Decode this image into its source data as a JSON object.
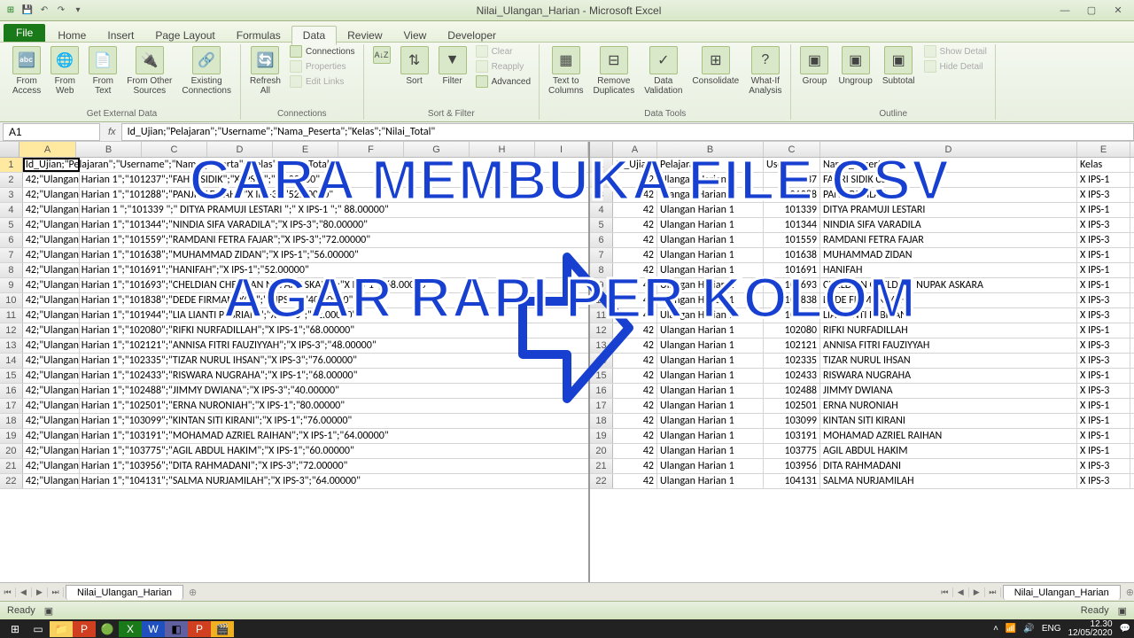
{
  "window": {
    "title": "Nilai_Ulangan_Harian - Microsoft Excel"
  },
  "tabs": {
    "file": "File",
    "list": [
      "Home",
      "Insert",
      "Page Layout",
      "Formulas",
      "Data",
      "Review",
      "View",
      "Developer"
    ],
    "active": "Data"
  },
  "ribbon": {
    "get_ext": {
      "label": "Get External Data",
      "btns": [
        "From\nAccess",
        "From\nWeb",
        "From\nText",
        "From Other\nSources",
        "Existing\nConnections"
      ]
    },
    "conn": {
      "label": "Connections",
      "refresh": "Refresh\nAll",
      "items": [
        "Connections",
        "Properties",
        "Edit Links"
      ]
    },
    "sort": {
      "label": "Sort & Filter",
      "sort": "Sort",
      "filter": "Filter",
      "items": [
        "Clear",
        "Reapply",
        "Advanced"
      ]
    },
    "tools": {
      "label": "Data Tools",
      "btns": [
        "Text to\nColumns",
        "Remove\nDuplicates",
        "Data\nValidation",
        "Consolidate",
        "What-If\nAnalysis"
      ]
    },
    "outline": {
      "label": "Outline",
      "btns": [
        "Group",
        "Ungroup",
        "Subtotal"
      ],
      "items": [
        "Show Detail",
        "Hide Detail"
      ]
    }
  },
  "fx": {
    "name": "A1",
    "formula": "Id_Ujian;\"Pelajaran\";\"Username\";\"Nama_Peserta\";\"Kelas\";\"Nilai_Total\""
  },
  "left_cols": [
    "A",
    "B",
    "C",
    "D",
    "E",
    "F",
    "G",
    "H",
    "I"
  ],
  "left_widths": [
    64,
    74,
    74,
    74,
    74,
    74,
    74,
    74,
    60
  ],
  "right_cols": [
    "A",
    "B",
    "C",
    "D",
    "E"
  ],
  "right_widths": [
    50,
    120,
    64,
    290,
    60
  ],
  "rows_left": [
    "Id_Ujian;\"Pelajaran\";\"Username\";\"Nama_Peserta\";\"Kelas\";\"Nilai_Total\"",
    "42;\"Ulangan Harian 1\";\"101237\";\"FAHRI SIDIK\";\"X IPS-1\";\"24.00000\"",
    "42;\"Ulangan Harian 1\";\"101288\";\"PANJI PADILAH\";\"X IPS-3\";\"52.00000\"",
    "42;\"Ulangan Harian 1 \";\"101339 \";\" DITYA PRAMUJI LESTARI \";\" X IPS-1 \";\" 88.00000\"",
    "42;\"Ulangan Harian 1\";\"101344\";\"NINDIA SIFA VARADILA\";\"X IPS-3\";\"80.00000\"",
    "42;\"Ulangan Harian 1\";\"101559\";\"RAMDANI FETRA FAJAR\";\"X IPS-3\";\"72.00000\"",
    "42;\"Ulangan Harian 1\";\"101638\";\"MUHAMMAD ZIDAN\";\"X IPS-1\";\"56.00000\"",
    "42;\"Ulangan Harian 1\";\"101691\";\"HANIFAH\";\"X IPS-1\";\"52.00000\"",
    "42;\"Ulangan Harian 1\";\"101693\";\"CHELDIAN CHELDIAN NUPAK ASKARA\";\"X IPS-1\";\"68.00000\"",
    "42;\"Ulangan Harian 1\";\"101838\";\"DEDE FIRMANSYAH\";\"X IPS-3\";\"40.00000\"",
    "42;\"Ulangan Harian 1\";\"101944\";\"LIA LIANTI PEBRIANI\";\"X IPS-3\";\"52.00000\"",
    "42;\"Ulangan Harian 1\";\"102080\";\"RIFKI NURFADILLAH\";\"X IPS-1\";\"68.00000\"",
    "42;\"Ulangan Harian 1\";\"102121\";\"ANNISA FITRI FAUZIYYAH\";\"X IPS-3\";\"48.00000\"",
    "42;\"Ulangan Harian 1\";\"102335\";\"TIZAR NURUL IHSAN\";\"X IPS-3\";\"76.00000\"",
    "42;\"Ulangan Harian 1\";\"102433\";\"RISWARA NUGRAHA\";\"X IPS-1\";\"68.00000\"",
    "42;\"Ulangan Harian 1\";\"102488\";\"JIMMY DWIANA\";\"X IPS-3\";\"40.00000\"",
    "42;\"Ulangan Harian 1\";\"102501\";\"ERNA NURONIAH\";\"X IPS-1\";\"80.00000\"",
    "42;\"Ulangan Harian 1\";\"103099\";\"KINTAN SITI KIRANI\";\"X IPS-1\";\"76.00000\"",
    "42;\"Ulangan Harian 1\";\"103191\";\"MOHAMAD AZRIEL RAIHAN\";\"X IPS-1\";\"64.00000\"",
    "42;\"Ulangan Harian 1\";\"103775\";\"AGIL ABDUL HAKIM\";\"X IPS-1\";\"60.00000\"",
    "42;\"Ulangan Harian 1\";\"103956\";\"DITA RAHMADANI\";\"X IPS-3\";\"72.00000\"",
    "42;\"Ulangan Harian 1\";\"104131\";\"SALMA NURJAMILAH\";\"X IPS-3\";\"64.00000\""
  ],
  "rows_right": [
    {
      "a": "Id_Ujian",
      "b": "Pelajaran",
      "c": "Username",
      "d": "Nama_Peserta",
      "e": "Kelas"
    },
    {
      "a": "42",
      "b": "Ulangan Harian 1",
      "c": "101237",
      "d": "FAHRI SIDIK CSV",
      "e": "X IPS-1"
    },
    {
      "a": "42",
      "b": "Ulangan Harian 1",
      "c": "101288",
      "d": "PANJI PADILAH",
      "e": "X IPS-3"
    },
    {
      "a": "42",
      "b": "Ulangan Harian 1",
      "c": "101339",
      "d": "DITYA PRAMUJI LESTARI",
      "e": "X IPS-1"
    },
    {
      "a": "42",
      "b": "Ulangan Harian 1",
      "c": "101344",
      "d": "NINDIA SIFA VARADILA",
      "e": "X IPS-3"
    },
    {
      "a": "42",
      "b": "Ulangan Harian 1",
      "c": "101559",
      "d": "RAMDANI FETRA FAJAR",
      "e": "X IPS-3"
    },
    {
      "a": "42",
      "b": "Ulangan Harian 1",
      "c": "101638",
      "d": "MUHAMMAD ZIDAN",
      "e": "X IPS-1"
    },
    {
      "a": "42",
      "b": "Ulangan Harian 1",
      "c": "101691",
      "d": "HANIFAH",
      "e": "X IPS-1"
    },
    {
      "a": "42",
      "b": "Ulangan Harian 1",
      "c": "101693",
      "d": "CHELDIAN CHELDIAN NUPAK ASKARA",
      "e": "X IPS-1"
    },
    {
      "a": "42",
      "b": "Ulangan Harian 1",
      "c": "101838",
      "d": "DEDE FIRMANSYAH",
      "e": "X IPS-3"
    },
    {
      "a": "42",
      "b": "Ulangan Harian 1",
      "c": "101944",
      "d": "LIA LIANTI PEBRIANI",
      "e": "X IPS-3"
    },
    {
      "a": "42",
      "b": "Ulangan Harian 1",
      "c": "102080",
      "d": "RIFKI NURFADILLAH",
      "e": "X IPS-1"
    },
    {
      "a": "42",
      "b": "Ulangan Harian 1",
      "c": "102121",
      "d": "ANNISA FITRI FAUZIYYAH",
      "e": "X IPS-3"
    },
    {
      "a": "42",
      "b": "Ulangan Harian 1",
      "c": "102335",
      "d": "TIZAR NURUL IHSAN",
      "e": "X IPS-3"
    },
    {
      "a": "42",
      "b": "Ulangan Harian 1",
      "c": "102433",
      "d": "RISWARA NUGRAHA",
      "e": "X IPS-1"
    },
    {
      "a": "42",
      "b": "Ulangan Harian 1",
      "c": "102488",
      "d": "JIMMY DWIANA",
      "e": "X IPS-3"
    },
    {
      "a": "42",
      "b": "Ulangan Harian 1",
      "c": "102501",
      "d": "ERNA NURONIAH",
      "e": "X IPS-1"
    },
    {
      "a": "42",
      "b": "Ulangan Harian 1",
      "c": "103099",
      "d": "KINTAN SITI KIRANI",
      "e": "X IPS-1"
    },
    {
      "a": "42",
      "b": "Ulangan Harian 1",
      "c": "103191",
      "d": "MOHAMAD AZRIEL RAIHAN",
      "e": "X IPS-1"
    },
    {
      "a": "42",
      "b": "Ulangan Harian 1",
      "c": "103775",
      "d": "AGIL ABDUL HAKIM",
      "e": "X IPS-1"
    },
    {
      "a": "42",
      "b": "Ulangan Harian 1",
      "c": "103956",
      "d": "DITA RAHMADANI",
      "e": "X IPS-3"
    },
    {
      "a": "42",
      "b": "Ulangan Harian 1",
      "c": "104131",
      "d": "SALMA NURJAMILAH",
      "e": "X IPS-3"
    }
  ],
  "sheet": {
    "name": "Nilai_Ulangan_Harian"
  },
  "status": {
    "ready": "Ready"
  },
  "overlay": {
    "l1": "CARA MEMBUKA FILE CSV",
    "l2": "AGAR RAPI PER KOLOM"
  },
  "tray": {
    "lang": "ENG",
    "time": "12.30",
    "date": "12/05/2020"
  }
}
